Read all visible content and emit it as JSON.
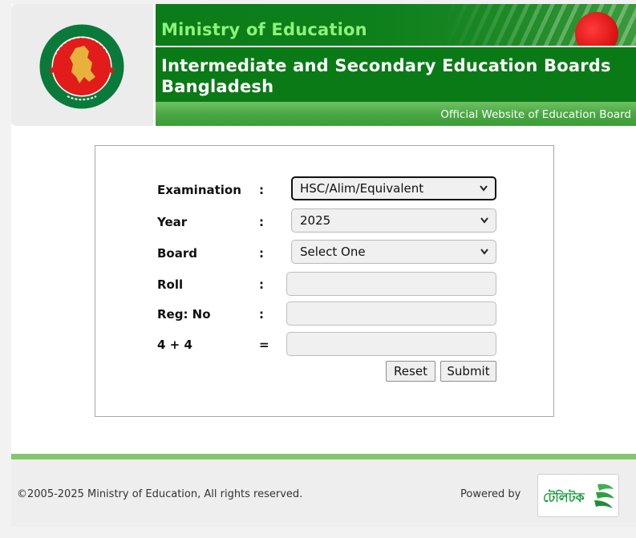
{
  "header": {
    "ministry": "Ministry of Education",
    "board_title": "Intermediate and Secondary Education Boards Bangladesh",
    "tagline": "Official Website of Education Board"
  },
  "form": {
    "examination": {
      "label": "Examination",
      "sep": ":",
      "value": "HSC/Alim/Equivalent"
    },
    "year": {
      "label": "Year",
      "sep": ":",
      "value": "2025"
    },
    "board": {
      "label": "Board",
      "sep": ":",
      "value": "Select One"
    },
    "roll": {
      "label": "Roll",
      "sep": ":",
      "value": ""
    },
    "reg": {
      "label": "Reg: No",
      "sep": ":",
      "value": ""
    },
    "captcha": {
      "label": "4 + 4",
      "sep": "=",
      "value": ""
    },
    "reset_label": "Reset",
    "submit_label": "Submit"
  },
  "footer": {
    "copyright": "©2005-2025 Ministry of Education, All rights reserved.",
    "powered_by": "Powered by",
    "logo_text": "টেলিটক"
  },
  "icons": {
    "govt_seal": "bangladesh-govt-seal-icon",
    "dropdown": "chevron-down-icon",
    "provider_logo": "teletalk-logo-icon"
  },
  "colors": {
    "header_green": "#0a7a17",
    "ministry_text": "#8df27a",
    "footer_line": "#82c66d",
    "seal_red": "#e21b1b",
    "seal_green": "#0a7a3a"
  }
}
